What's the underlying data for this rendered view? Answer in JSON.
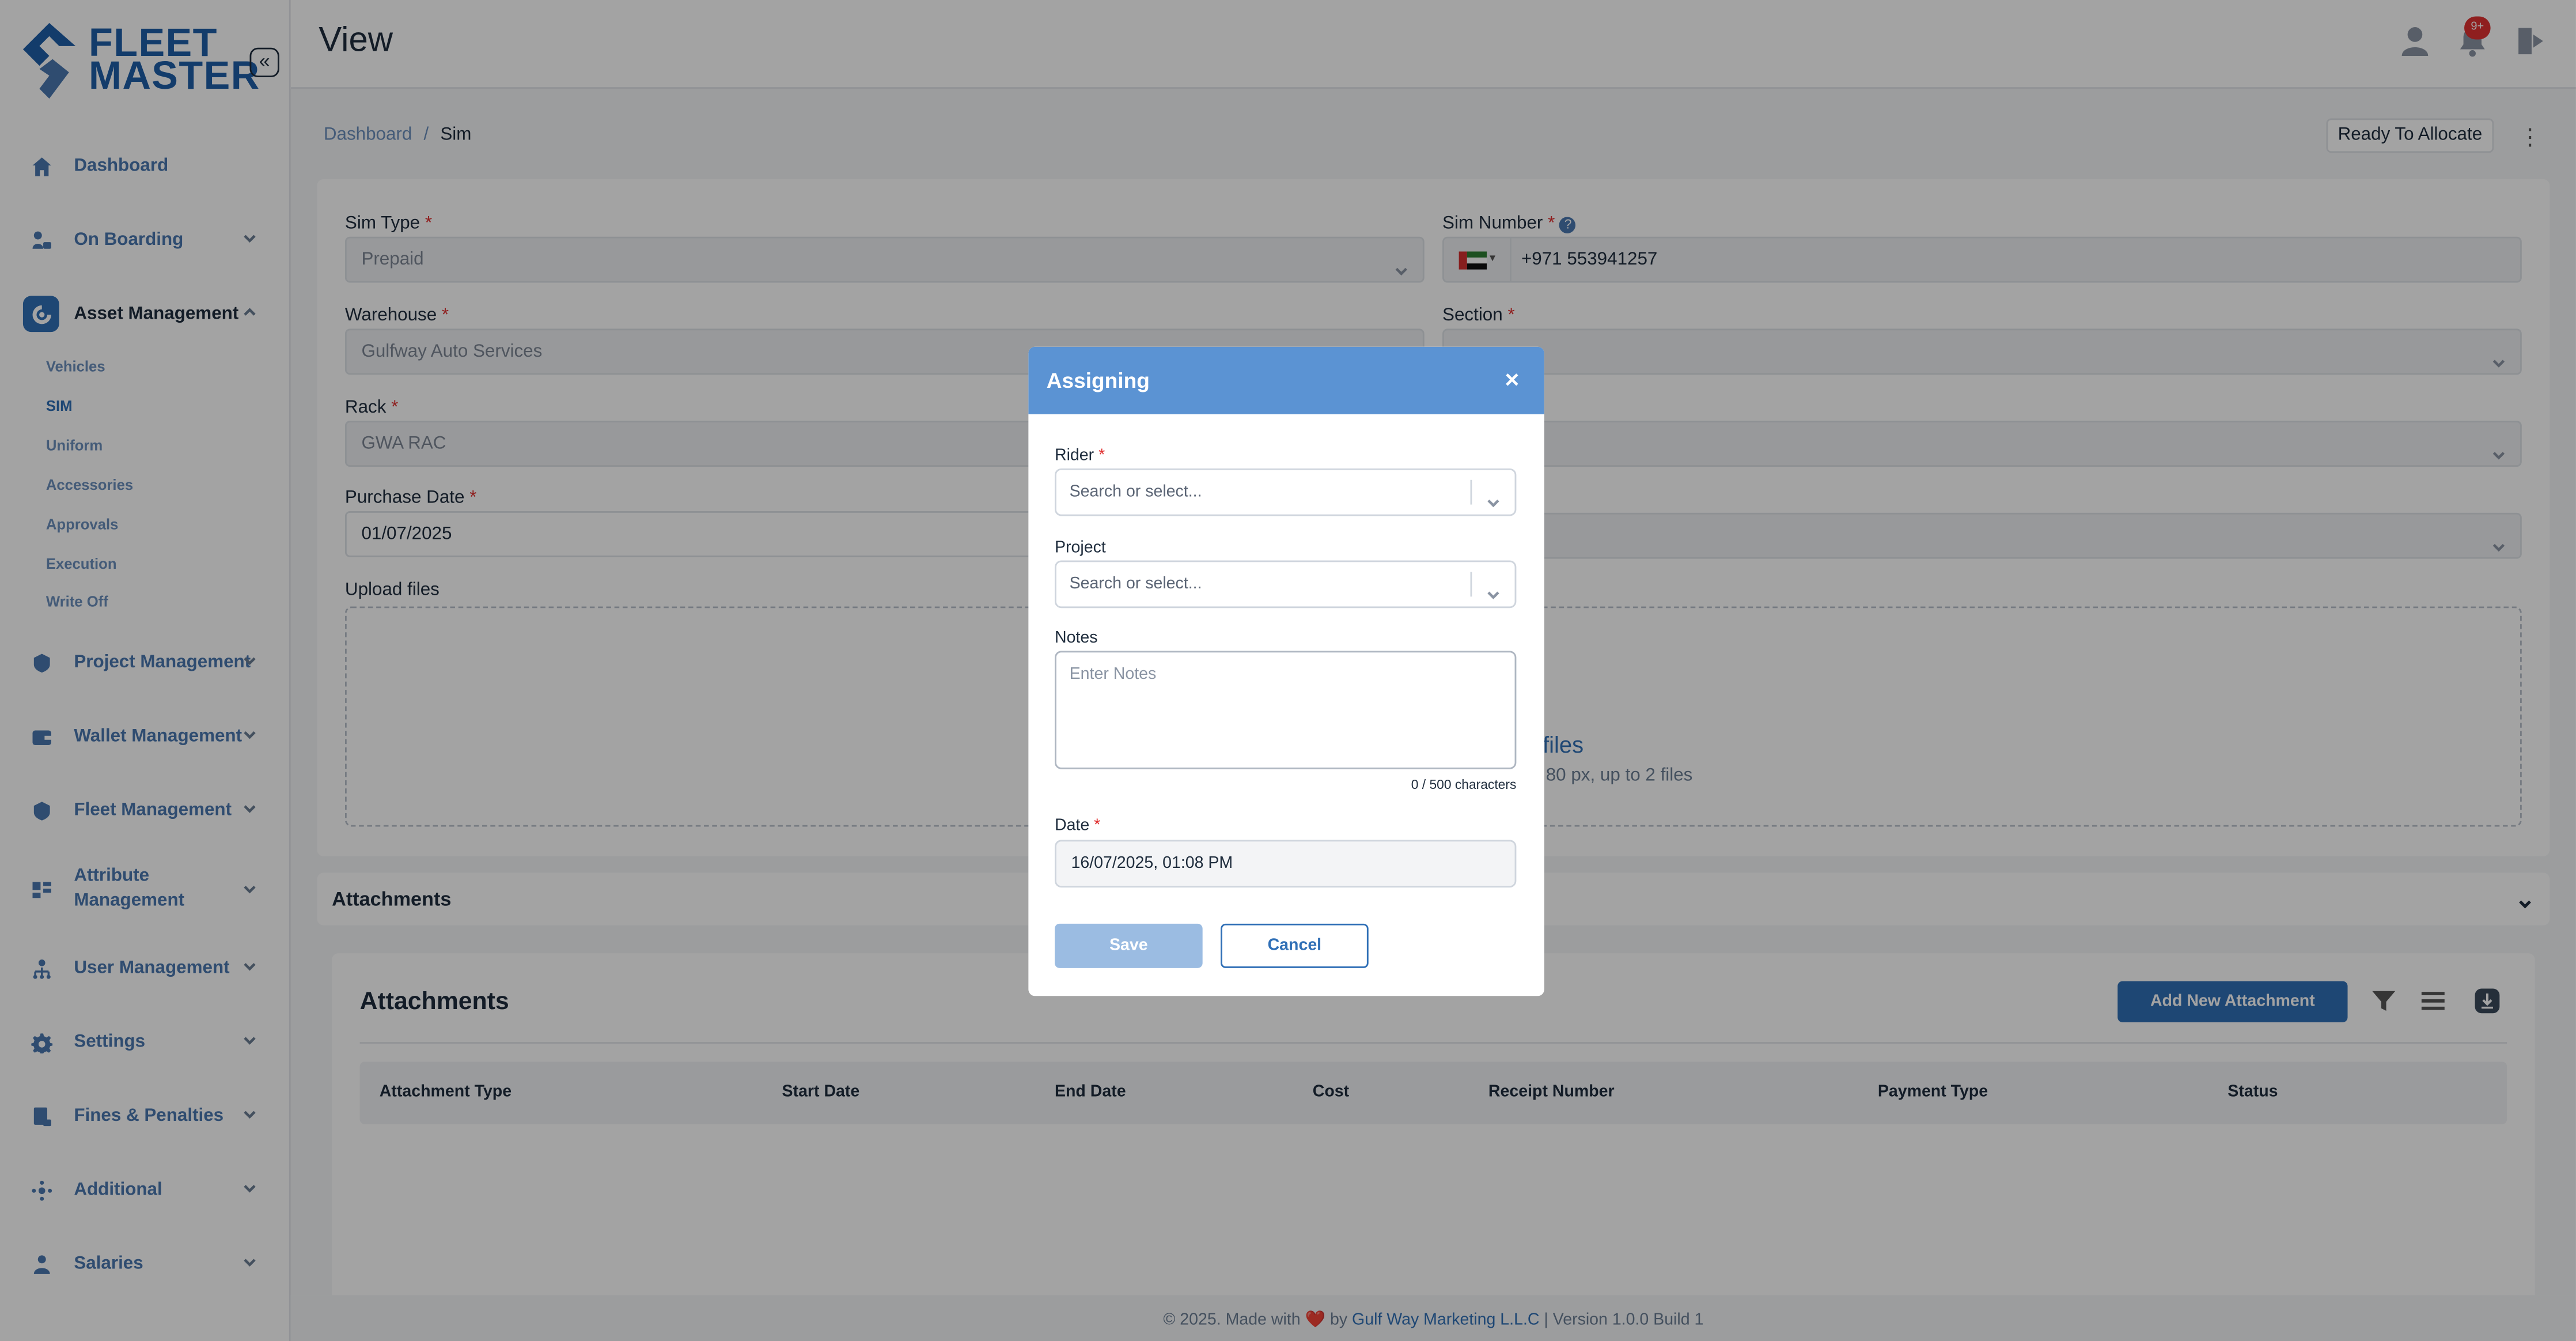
{
  "brand": {
    "line1": "FLEET",
    "line2": "MASTER"
  },
  "sidebar": {
    "collapse_icon": "double-chevron-left-icon",
    "items": [
      {
        "label": "Dashboard",
        "icon": "home-icon"
      },
      {
        "label": "On Boarding",
        "icon": "onboarding-icon"
      },
      {
        "label": "Asset Management",
        "icon": "asset-icon"
      },
      {
        "label": "Project Management",
        "icon": "project-icon"
      },
      {
        "label": "Wallet Management",
        "icon": "wallet-icon"
      },
      {
        "label": "Fleet Management",
        "icon": "fleet-icon"
      },
      {
        "label": "Attribute Management",
        "icon": "attribute-icon"
      },
      {
        "label": "User Management",
        "icon": "users-icon"
      },
      {
        "label": "Settings",
        "icon": "gear-icon"
      },
      {
        "label": "Fines & Penalties",
        "icon": "fines-icon"
      },
      {
        "label": "Additional",
        "icon": "additional-icon"
      },
      {
        "label": "Salaries",
        "icon": "salaries-icon"
      }
    ],
    "asset_sub_items": [
      "Vehicles",
      "SIM",
      "Uniform",
      "Accessories",
      "Approvals",
      "Execution",
      "Write Off"
    ],
    "active_sub": "SIM"
  },
  "header": {
    "title": "View",
    "notification_badge": "9+"
  },
  "breadcrumb": {
    "home": "Dashboard",
    "separator": "/",
    "current": "Sim"
  },
  "status_button": "Ready To Allocate",
  "form": {
    "sim_type": {
      "label": "Sim Type",
      "value": "Prepaid"
    },
    "sim_number": {
      "label": "Sim Number",
      "value": "+971 553941257"
    },
    "warehouse": {
      "label": "Warehouse",
      "value": "Gulfway Auto Services"
    },
    "section": {
      "label": "Section"
    },
    "rack": {
      "label": "Rack",
      "value": "GWA RAC"
    },
    "purchase_date": {
      "label": "Purchase Date",
      "value": "01/07/2025"
    },
    "upload": {
      "label": "Upload files",
      "link": "files",
      "hint": "80 px, up to 2 files"
    }
  },
  "attachments_accordion": {
    "title": "Attachments"
  },
  "attachments": {
    "title": "Attachments",
    "add_button": "Add New Attachment",
    "columns": [
      "Attachment Type",
      "Start Date",
      "End Date",
      "Cost",
      "Receipt Number",
      "Payment Type",
      "Status"
    ]
  },
  "footer": {
    "prefix": "© 2025. Made with",
    "heart": "❤️",
    "by": "by",
    "company": "Gulf Way Marketing L.L.C",
    "version": "| Version 1.0.0 Build 1"
  },
  "modal": {
    "title": "Assigning",
    "close": "×",
    "rider": {
      "label": "Rider",
      "placeholder": "Search or select..."
    },
    "project": {
      "label": "Project",
      "placeholder": "Search or select..."
    },
    "notes": {
      "label": "Notes",
      "placeholder": "Enter Notes",
      "counter": "0 / 500 characters"
    },
    "date": {
      "label": "Date",
      "value": "16/07/2025, 01:08 PM"
    },
    "save": "Save",
    "cancel": "Cancel"
  },
  "colors": {
    "primary": "#2f6fb6",
    "modal_header": "#5b93d3",
    "required": "#e03131"
  }
}
